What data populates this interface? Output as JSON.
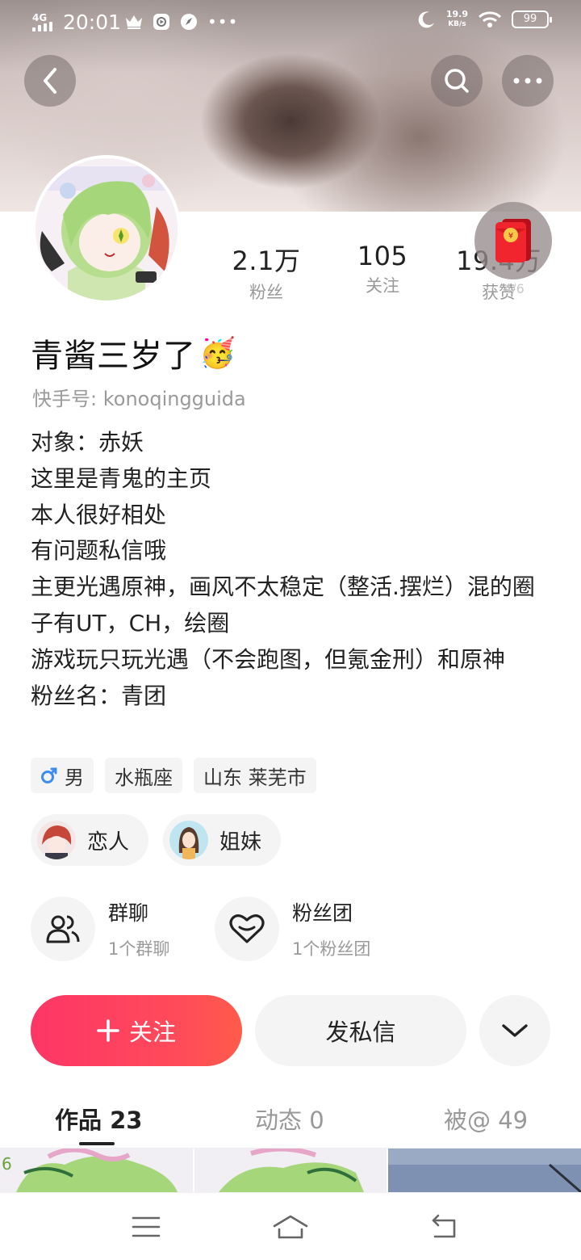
{
  "status_bar": {
    "network": "4G",
    "time": "20:01",
    "speed_value": "19.9",
    "speed_unit": "KB/s",
    "battery": "99"
  },
  "profile": {
    "name": "青酱三岁了",
    "name_emoji": "🥳",
    "user_id": "快手号: konoqingguida",
    "bio_lines": [
      "对象：赤妖",
      "这里是青鬼的主页",
      "本人很好相处",
      "有问题私信哦",
      "主更光遇原神，画风不太稳定（整活.摆烂）混的圈子有UT，CH，绘圈",
      "游戏玩只玩光遇（不会跑图，但氪金刑）和原神",
      "粉丝名：青团"
    ]
  },
  "stats": [
    {
      "value": "2.1万",
      "label": "粉丝"
    },
    {
      "value": "105",
      "label": "关注"
    },
    {
      "value": "19.4万",
      "label": "获赞"
    }
  ],
  "red_packet": {
    "count": "4/6"
  },
  "tags": [
    {
      "label": "男",
      "icon": "male-icon"
    },
    {
      "label": "水瓶座"
    },
    {
      "label": "山东 莱芜市"
    }
  ],
  "relations": [
    {
      "label": "恋人"
    },
    {
      "label": "姐妹"
    }
  ],
  "groups": {
    "chat": {
      "title": "群聊",
      "subtitle": "1个群聊"
    },
    "fan_club": {
      "title": "粉丝团",
      "subtitle": "1个粉丝团"
    }
  },
  "actions": {
    "follow": "关注",
    "message": "发私信"
  },
  "tabs": [
    {
      "label": "作品 23",
      "active": true
    },
    {
      "label": "动态 0"
    },
    {
      "label": "被@ 49"
    }
  ],
  "colors": {
    "accent": "#fe3666",
    "muted": "#9a9a9a",
    "chip_bg": "#f4f4f4",
    "male": "#3d8cf0"
  }
}
